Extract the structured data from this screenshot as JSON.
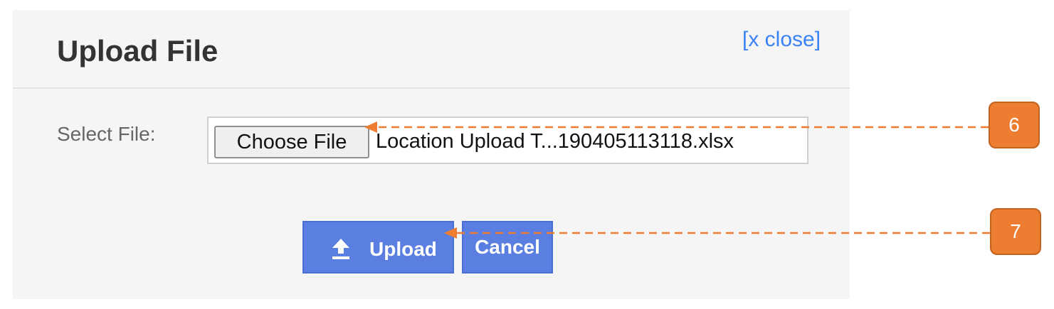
{
  "dialog": {
    "title": "Upload File",
    "close_label": "[x close]",
    "select_label": "Select File:",
    "choose_file_label": "Choose File",
    "file_name": "Location Upload T...190405113118.xlsx",
    "upload_label": "Upload",
    "cancel_label": "Cancel"
  },
  "annotations": [
    {
      "number": "6",
      "target": "choose-file-button"
    },
    {
      "number": "7",
      "target": "upload-button"
    }
  ],
  "colors": {
    "link": "#3b82f6",
    "primary_button": "#5b7fe0",
    "callout": "#ed7d31",
    "dialog_background": "#f5f5f5"
  },
  "icons": {
    "upload": "upload-arrow-icon"
  }
}
